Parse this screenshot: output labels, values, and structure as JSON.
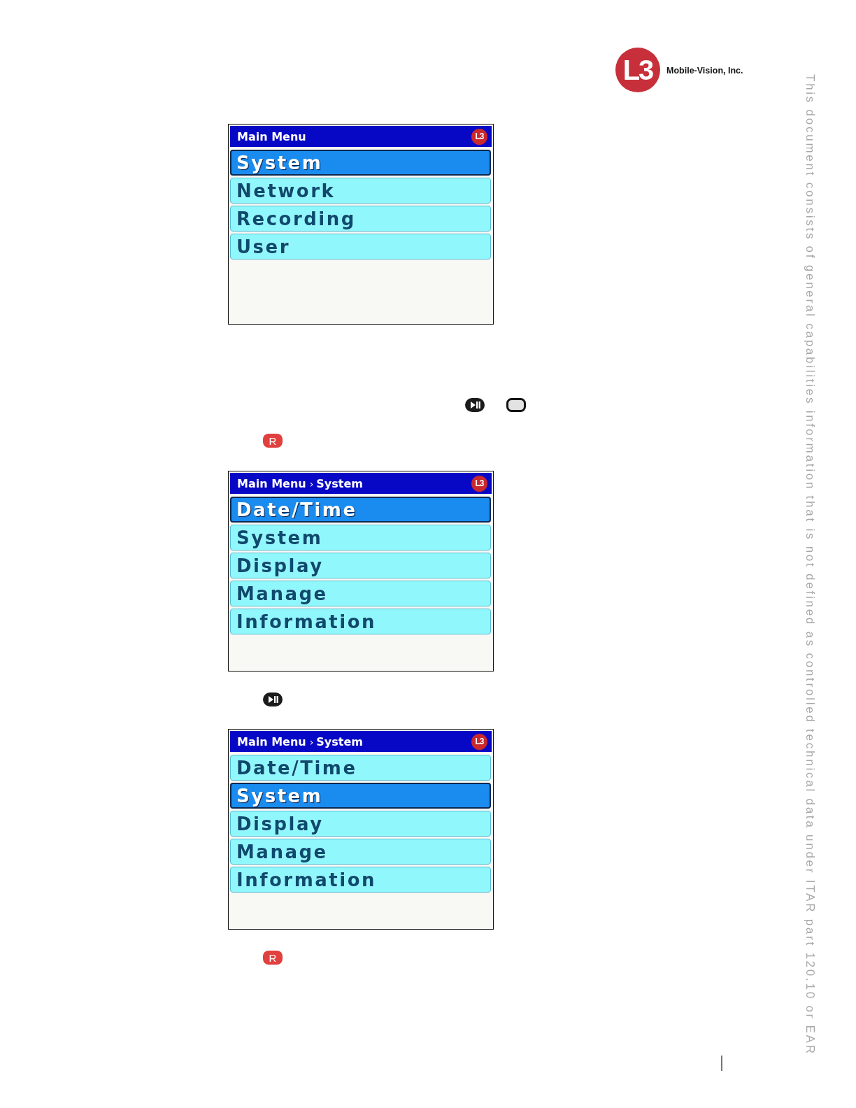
{
  "header": {
    "logo_mark": "L3",
    "company": "Mobile-Vision, Inc."
  },
  "steps": [
    {
      "kind": "screen",
      "breadcrumb": [
        "Main Menu"
      ],
      "logo": "L3",
      "items": [
        {
          "label": "System",
          "selected": true
        },
        {
          "label": "Network",
          "selected": false
        },
        {
          "label": "Recording",
          "selected": false
        },
        {
          "label": "User",
          "selected": false
        }
      ]
    },
    {
      "kind": "keys",
      "keys": [
        {
          "kind": "play-pause"
        },
        {
          "kind": "square"
        }
      ]
    },
    {
      "kind": "keys",
      "keys": [
        {
          "kind": "letter",
          "label": "R"
        }
      ]
    },
    {
      "kind": "screen",
      "breadcrumb": [
        "Main Menu",
        "System"
      ],
      "separator": "›",
      "logo": "L3",
      "items": [
        {
          "label": "Date/Time",
          "selected": true
        },
        {
          "label": "System",
          "selected": false
        },
        {
          "label": "Display",
          "selected": false
        },
        {
          "label": "Manage",
          "selected": false
        },
        {
          "label": "Information",
          "selected": false
        }
      ]
    },
    {
      "kind": "keys",
      "keys": [
        {
          "kind": "play-pause"
        }
      ]
    },
    {
      "kind": "screen",
      "breadcrumb": [
        "Main Menu",
        "System"
      ],
      "separator": "›",
      "logo": "L3",
      "items": [
        {
          "label": "Date/Time",
          "selected": false
        },
        {
          "label": "System",
          "selected": true
        },
        {
          "label": "Display",
          "selected": false
        },
        {
          "label": "Manage",
          "selected": false
        },
        {
          "label": "Information",
          "selected": false
        }
      ]
    },
    {
      "kind": "keys",
      "keys": [
        {
          "kind": "letter",
          "label": "R"
        }
      ]
    }
  ],
  "side_notice": "This document consists of general capabilities information that is not defined as controlled technical data under ITAR part 120.10 or EAR"
}
